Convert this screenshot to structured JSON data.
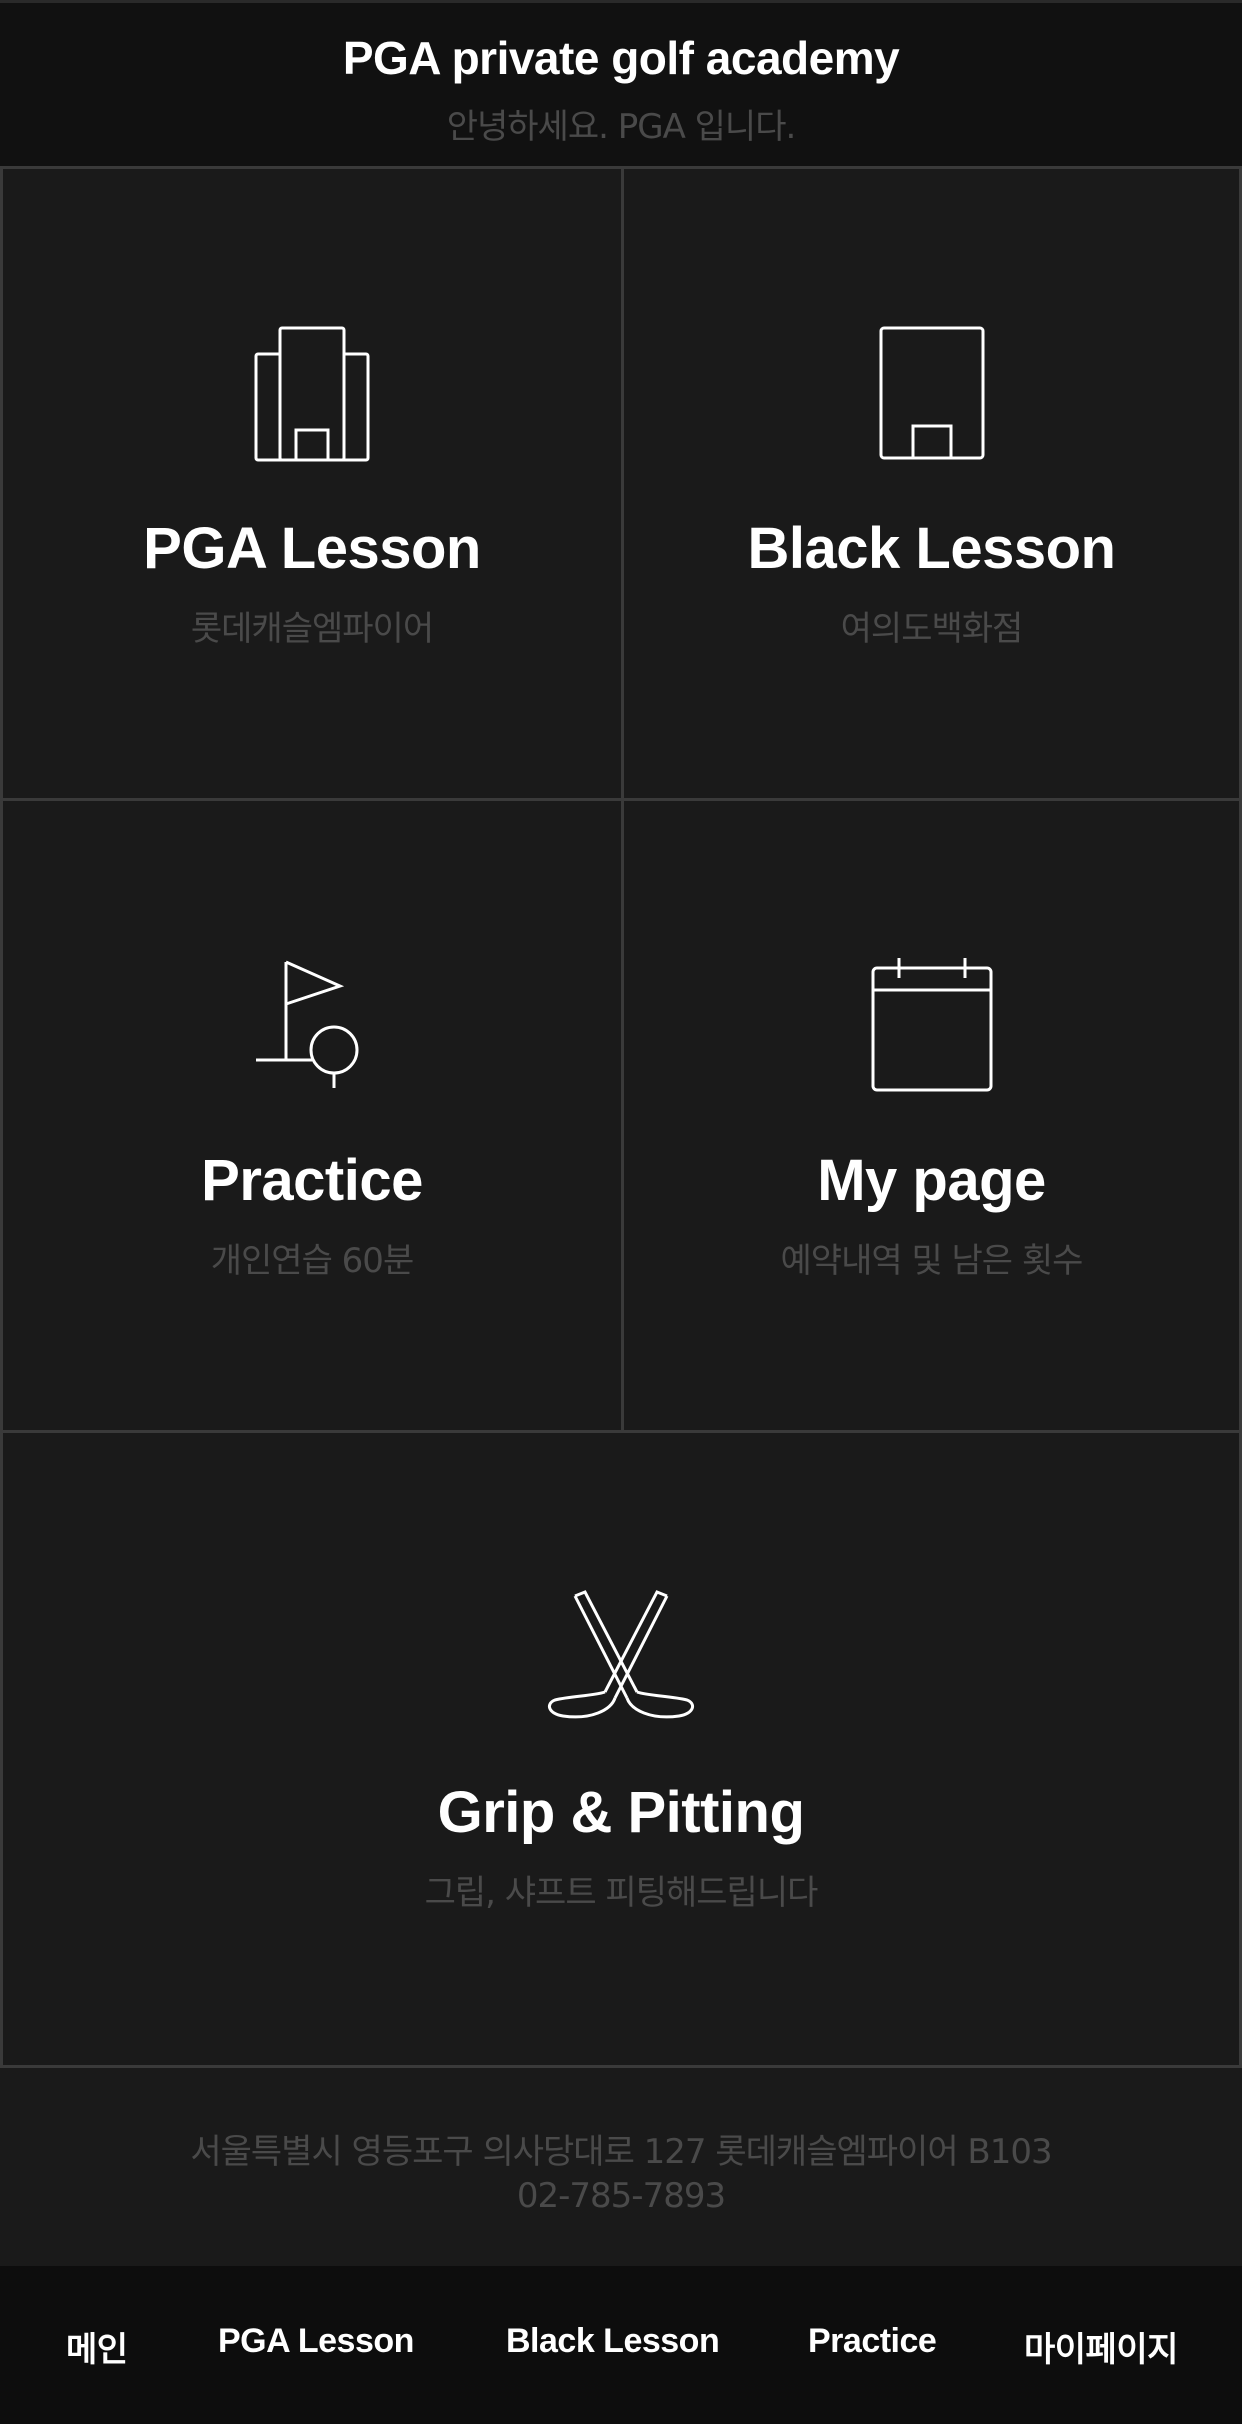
{
  "header": {
    "title": "PGA private golf academy",
    "subtitle": "안녕하세요. PGA 입니다."
  },
  "tiles": [
    {
      "title": "PGA Lesson",
      "subtitle": "롯데캐슬엠파이어",
      "icon": "building-icon"
    },
    {
      "title": "Black Lesson",
      "subtitle": "여의도백화점",
      "icon": "door-building-icon"
    },
    {
      "title": "Practice",
      "subtitle": "개인연습 60분",
      "icon": "golf-flag-icon"
    },
    {
      "title": "My page",
      "subtitle": "예약내역 및 남은 횟수",
      "icon": "calendar-icon"
    },
    {
      "title": "Grip & Pitting",
      "subtitle": "그립, 샤프트 피팅해드립니다",
      "icon": "crossed-golf-clubs-icon"
    }
  ],
  "footer": {
    "address": "서울특별시 영등포구 의사당대로 127 롯데캐슬엠파이어 B103",
    "phone": "02-785-7893"
  },
  "nav": {
    "items": [
      "메인",
      "PGA Lesson",
      "Black Lesson",
      "Practice",
      "마이페이지"
    ]
  },
  "colors": {
    "background": "#1a1a1a",
    "header": "#111111",
    "nav": "#0d0d0d",
    "border": "#3a3a3a",
    "muted_text": "#4a4a4a"
  }
}
